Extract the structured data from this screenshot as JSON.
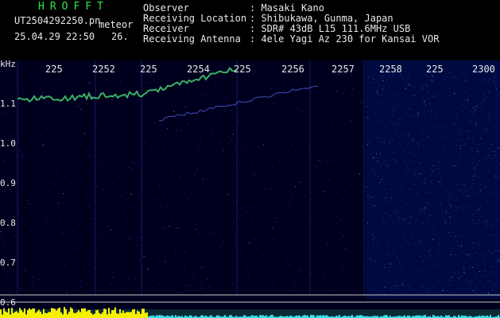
{
  "header": {
    "brand": "HROFFT",
    "filename": "UT2504292250.pn",
    "suffix": "meteor",
    "datetime": "25.04.29 22:50",
    "counter": "26.",
    "labels": {
      "observer": "Observer",
      "location": "Receiving Location",
      "receiver": "Receiver",
      "antenna": "Receiving Antenna"
    },
    "values": {
      "observer": ": Masaki Kano",
      "location": ": Shibukawa, Gunma, Japan",
      "receiver": ": SDR# 43dB L15 111.6MHz USB",
      "antenna": ": 4ele Yagi Az 230 for Kansai VOR"
    }
  },
  "axis": {
    "unit": "kHz",
    "y_ticks": [
      "1.1",
      "1.0",
      "0.9",
      "0.8",
      "0.7",
      "0.6"
    ],
    "x_ticks": [
      "225",
      "2252",
      "225",
      "2254",
      "225",
      "2256",
      "2257",
      "2258",
      "225",
      "2300"
    ]
  },
  "colors": {
    "background": "#000000",
    "text": "#e8e8e8",
    "brand": "#2ee84a",
    "noise": "#1e3cc8",
    "signal": "#44d070",
    "meter_yellow": "#f4f000",
    "meter_cyan": "#38e0e8"
  }
}
